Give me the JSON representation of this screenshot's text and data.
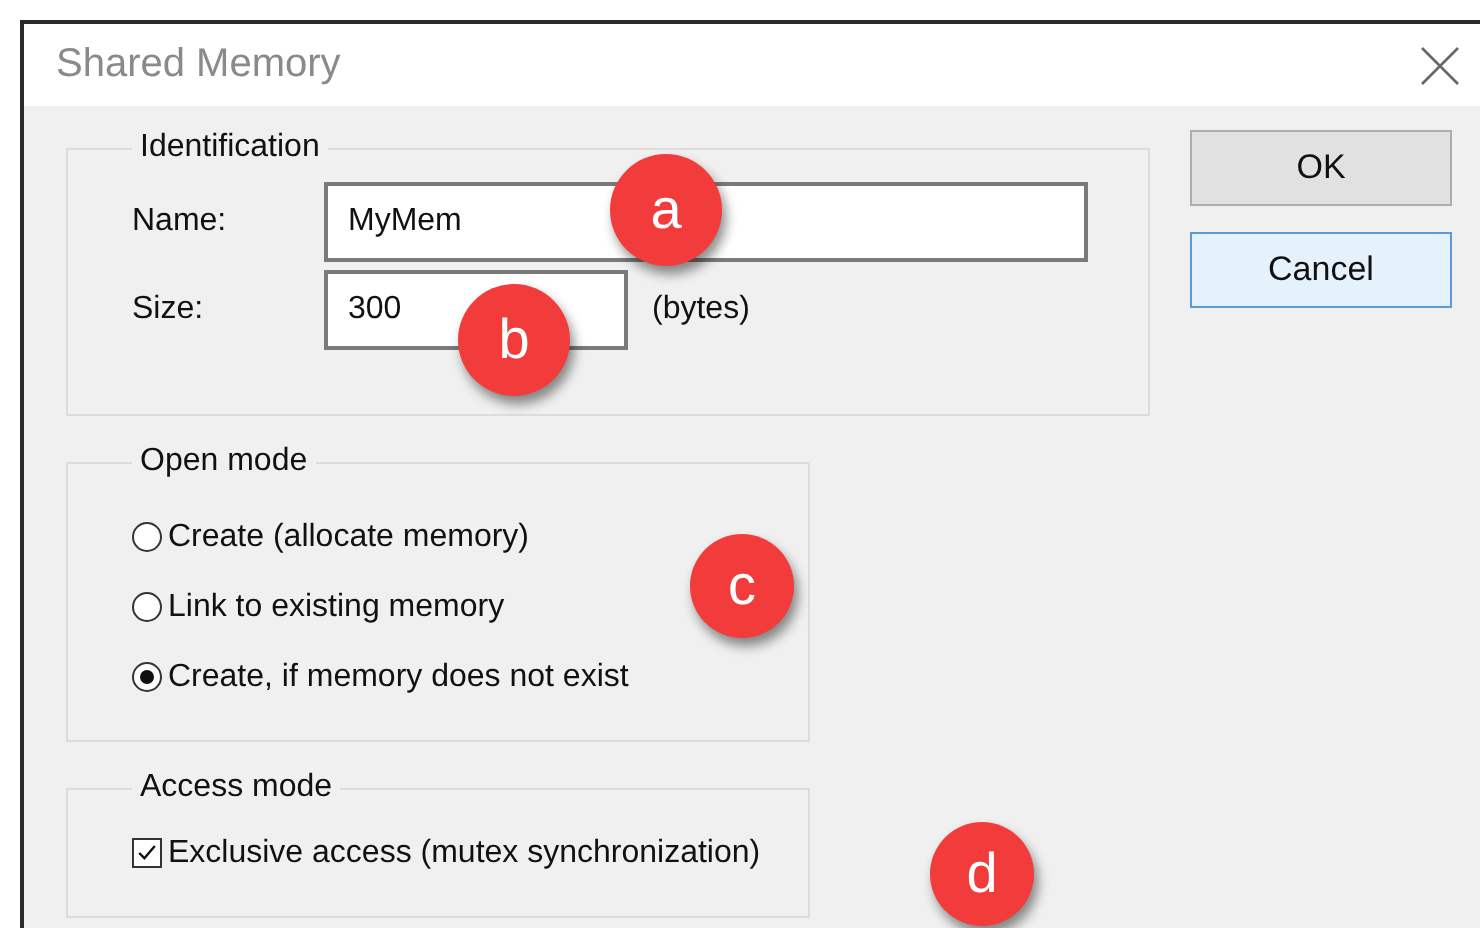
{
  "window": {
    "title": "Shared Memory"
  },
  "identification": {
    "title": "Identification",
    "name_label": "Name:",
    "name_value": "MyMem",
    "size_label": "Size:",
    "size_value": "300",
    "size_unit": "(bytes)"
  },
  "open_mode": {
    "title": "Open mode",
    "options": [
      {
        "label": "Create (allocate memory)",
        "selected": false
      },
      {
        "label": "Link to existing memory",
        "selected": false
      },
      {
        "label": "Create, if memory does not exist",
        "selected": true
      }
    ]
  },
  "access_mode": {
    "title": "Access mode",
    "options": [
      {
        "label": "Exclusive access (mutex synchronization)",
        "checked": true
      }
    ]
  },
  "buttons": [
    {
      "label": "OK",
      "kind": "default"
    },
    {
      "label": "Cancel",
      "kind": "focused"
    }
  ],
  "annotations": [
    "a",
    "b",
    "c",
    "d"
  ]
}
